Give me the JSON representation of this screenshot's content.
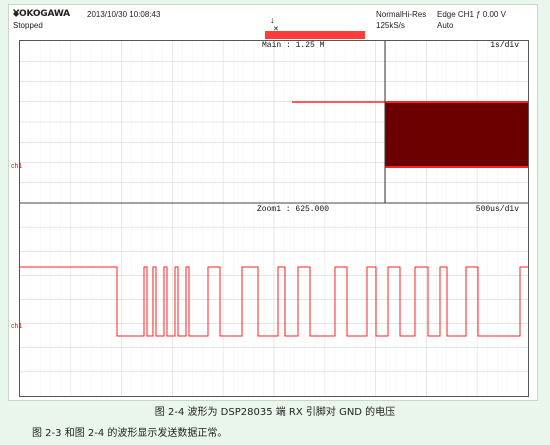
{
  "header": {
    "brand": "YOKOGAWA",
    "brand_mark": "◆",
    "datetime": "2013/10/30 10:08:43",
    "status": "Stopped",
    "trigger_marker": "↓",
    "trigger_cross": "✕",
    "mode_line1": "Normal",
    "mode_line2": "125kS/s",
    "hires_label": "Hi-Res",
    "trigger_line1": "Edge CH1 ƒ 0.00 V",
    "trigger_line2": "Auto"
  },
  "trigger_bar_text": "",
  "main_panel": {
    "label": "Main : 1.25 M",
    "time_div": "1s/div",
    "channel_marker": "ch1"
  },
  "zoom_panel": {
    "label": "Zoom1 : 625.000",
    "time_div": "500us/div",
    "channel_marker": "ch1"
  },
  "caption": "图 2-4 波形为 DSP28035 端 RX 引脚对 GND 的电压",
  "note": "图 2-3 和图 2-4 的波形显示发送数据正常。",
  "colors": {
    "trace": "#ff2020",
    "trace_dark": "#6b0000",
    "grid": "#d9d9d9",
    "trigger_bar": "#ff3b3b"
  }
}
